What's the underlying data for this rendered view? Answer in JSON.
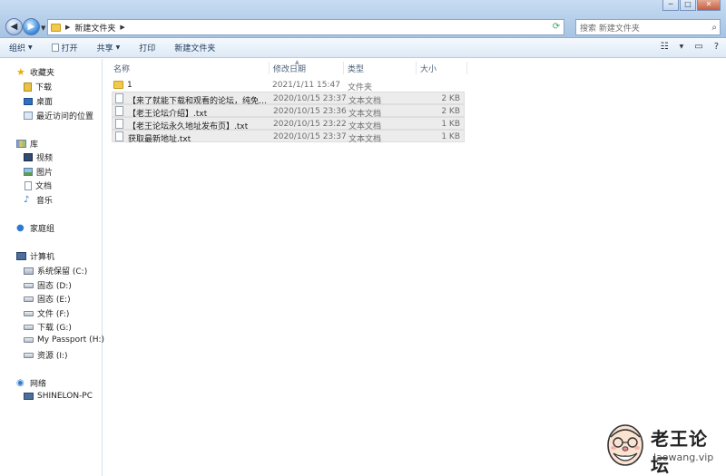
{
  "window": {
    "controls": {
      "minimize": "─",
      "maximize": "□",
      "close": "✕"
    }
  },
  "address": {
    "path": [
      "新建文件夹"
    ],
    "search_placeholder": "搜索 新建文件夹"
  },
  "toolbar": {
    "organize": "组织",
    "open": "打开",
    "share": "共享",
    "print": "打印",
    "new_folder": "新建文件夹"
  },
  "nav": {
    "favorites": "收藏夹",
    "downloads": "下载",
    "desktop": "桌面",
    "recent": "最近访问的位置",
    "libraries": "库",
    "videos": "视频",
    "pictures": "图片",
    "documents": "文档",
    "music": "音乐",
    "homegroup": "家庭组",
    "computer": "计算机",
    "drives": [
      {
        "label": "系统保留 (C:)"
      },
      {
        "label": "固态 (D:)"
      },
      {
        "label": "固态 (E:)"
      },
      {
        "label": "文件 (F:)"
      },
      {
        "label": "下载 (G:)"
      },
      {
        "label": "My Passport (H:)"
      },
      {
        "label": "资源 (I:)"
      }
    ],
    "network": "网络",
    "network_pc": "SHINELON-PC"
  },
  "columns": {
    "name": "名称",
    "date": "修改日期",
    "type": "类型",
    "size": "大小"
  },
  "files": [
    {
      "name": "1",
      "date": "2021/1/11 15:47",
      "type": "文件夹",
      "size": "",
      "kind": "folder"
    },
    {
      "name": "【来了就能下载和观看的论坛，纯免费！...",
      "date": "2020/10/15 23:37",
      "type": "文本文档",
      "size": "2 KB",
      "kind": "file"
    },
    {
      "name": "【老王论坛介绍】.txt",
      "date": "2020/10/15 23:36",
      "type": "文本文档",
      "size": "2 KB",
      "kind": "file"
    },
    {
      "name": "【老王论坛永久地址发布页】.txt",
      "date": "2020/10/15 23:22",
      "type": "文本文档",
      "size": "1 KB",
      "kind": "file"
    },
    {
      "name": "获取最新地址.txt",
      "date": "2020/10/15 23:37",
      "type": "文本文档",
      "size": "1 KB",
      "kind": "file"
    }
  ],
  "watermark": {
    "title": "老王论坛",
    "url": "laowang.vip"
  }
}
